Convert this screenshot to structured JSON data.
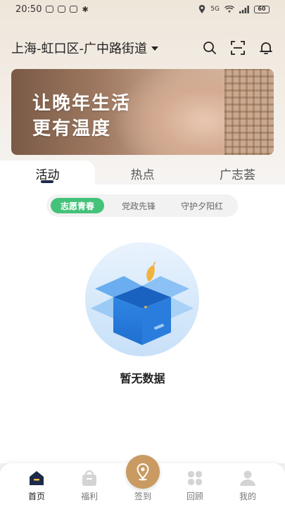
{
  "status_bar": {
    "time": "20:50",
    "battery": "60",
    "network": "5G"
  },
  "header": {
    "location": "上海-虹口区-广中路街道"
  },
  "banner": {
    "line1": "让晚年生活",
    "line2": "更有温度"
  },
  "tabs": [
    {
      "label": "活动",
      "active": true
    },
    {
      "label": "热点",
      "active": false
    },
    {
      "label": "广志荟",
      "active": false
    }
  ],
  "subtabs": [
    {
      "label": "志愿青春",
      "active": true
    },
    {
      "label": "党政先锋",
      "active": false
    },
    {
      "label": "守护夕阳红",
      "active": false
    }
  ],
  "empty_state": {
    "text": "暂无数据"
  },
  "bottom_nav": [
    {
      "label": "首页",
      "icon": "home-icon",
      "active": true
    },
    {
      "label": "福利",
      "icon": "bag-icon",
      "active": false
    },
    {
      "label": "签到",
      "icon": "location-pin-icon",
      "active": false
    },
    {
      "label": "回顾",
      "icon": "grid-icon",
      "active": false
    },
    {
      "label": "我的",
      "icon": "user-icon",
      "active": false
    }
  ],
  "colors": {
    "accent_green": "#45c27a",
    "checkin_gold": "#c99a62",
    "nav_dark": "#1d2a4a"
  }
}
